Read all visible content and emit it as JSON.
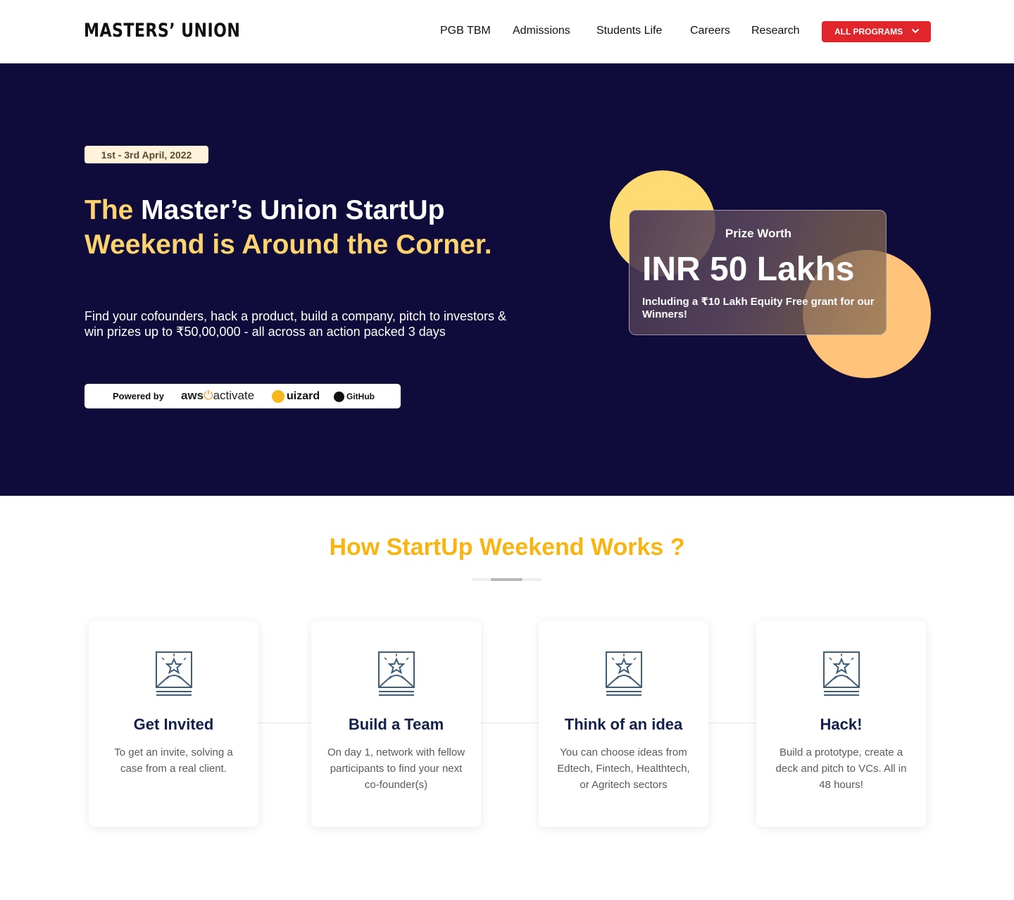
{
  "header": {
    "logo": "MASTERS’ UNION",
    "nav": [
      "PGB TBM",
      "Admissions",
      "Students Life",
      "Careers",
      "Research"
    ],
    "cta_label": "ALL PROGRAMS",
    "cta_icon": "chevron-down-icon",
    "cta_color": "#e0262a"
  },
  "hero": {
    "date": "1st - 3rd April, 2022",
    "headline_part1": "The ",
    "headline_part2": "Master’s Union StartUp",
    "headline_part3": "Weekend is Around the Corner.",
    "subtext": "Find your cofounders, hack a product, build a company, pitch to investors & win prizes up to ₹50,00,000 - all across an action packed 3 days",
    "powered_label": "Powered by",
    "sponsors": {
      "aws_a": "aws",
      "aws_b": "activate",
      "uizard": "uizard",
      "github": "GitHub"
    },
    "prize": {
      "label": "Prize Worth",
      "amount": "INR 50 Lakhs",
      "note": "Including a ₹10 Lakh Equity Free grant for our Winners!"
    },
    "background_color": "#0f0b3a",
    "accent_color": "#fdd36f"
  },
  "how_it_works": {
    "title": "How StartUp Weekend Works ?",
    "title_color": "#f8b512",
    "steps": [
      {
        "title": "Get Invited",
        "desc": "To get an invite, solving a case from a real client.",
        "icon": "award-envelope-icon"
      },
      {
        "title": "Build a Team",
        "desc": "On day 1, network with fellow participants to find your next co-founder(s)",
        "icon": "award-envelope-icon"
      },
      {
        "title": "Think of an idea",
        "desc": "You can choose ideas from Edtech, Fintech, Healthtech, or Agritech sectors",
        "icon": "award-envelope-icon"
      },
      {
        "title": "Hack!",
        "desc": "Build a prototype, create a deck and pitch to VCs. All in 48 hours!",
        "icon": "award-envelope-icon"
      }
    ]
  }
}
